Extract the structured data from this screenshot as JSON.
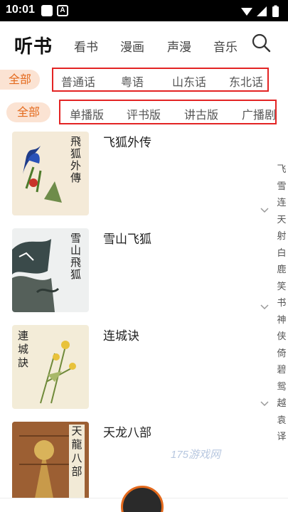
{
  "status_bar": {
    "time": "10:01",
    "app_badge": "A"
  },
  "header": {
    "logo": "听书",
    "nav": [
      "看书",
      "漫画",
      "声漫",
      "音乐"
    ]
  },
  "language_filter": {
    "all_label": "全部",
    "options": [
      "普通话",
      "粤语",
      "山东话",
      "东北话"
    ]
  },
  "format_filter": {
    "all_label": "全部",
    "options": [
      "单播版",
      "评书版",
      "讲古版",
      "广播剧"
    ]
  },
  "books": [
    {
      "title": "飞狐外传",
      "cover_text": "飛狐外傳"
    },
    {
      "title": "雪山飞狐",
      "cover_text": "雪山飛狐"
    },
    {
      "title": "连城诀",
      "cover_text": "連城訣"
    },
    {
      "title": "天龙八部",
      "cover_text": "天龍八部"
    }
  ],
  "side_index": [
    "飞",
    "雪",
    "连",
    "天",
    "射",
    "白",
    "鹿",
    "笑",
    "书",
    "神",
    "侠",
    "倚",
    "碧",
    "鸳",
    "越",
    "袁",
    "译"
  ],
  "watermark": "175游戏网"
}
